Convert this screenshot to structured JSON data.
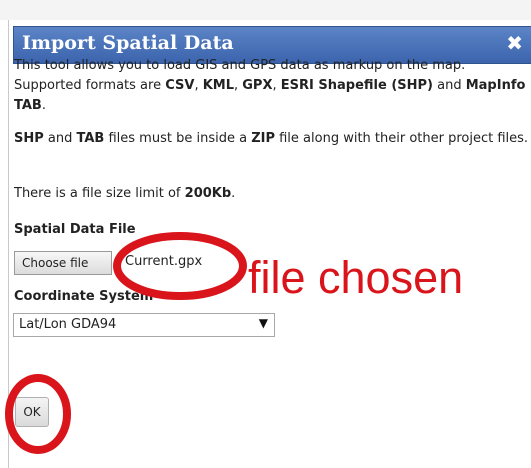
{
  "dialog": {
    "title": "Import Spatial Data",
    "close_icon": "close-icon",
    "para1_a": "This tool allows you to load GIS and GPS data as markup on the map. Supported formats are ",
    "para1_csv": "CSV",
    "para1_sep1": ", ",
    "para1_kml": "KML",
    "para1_sep2": ", ",
    "para1_gpx": "GPX",
    "para1_sep3": ", ",
    "para1_shp": "ESRI Shapefile (SHP)",
    "para1_and": " and ",
    "para1_tab": "MapInfo TAB",
    "para1_end": ".",
    "para2_shp": "SHP",
    "para2_and": " and ",
    "para2_tab": "TAB",
    "para2_mid": " files must be inside a ",
    "para2_zip": "ZIP",
    "para2_end": " file along with their other project files.",
    "para3_a": "There is a file size limit of ",
    "para3_limit": "200Kb",
    "para3_end": ".",
    "spatial_label": "Spatial Data File",
    "choose_file_label": "Choose file",
    "file_name": "Current.gpx",
    "coord_label": "Coordinate System",
    "coord_value": "Lat/Lon GDA94",
    "ok_label": "OK"
  },
  "annotation": {
    "text": "file chosen",
    "color": "#d9151b"
  }
}
